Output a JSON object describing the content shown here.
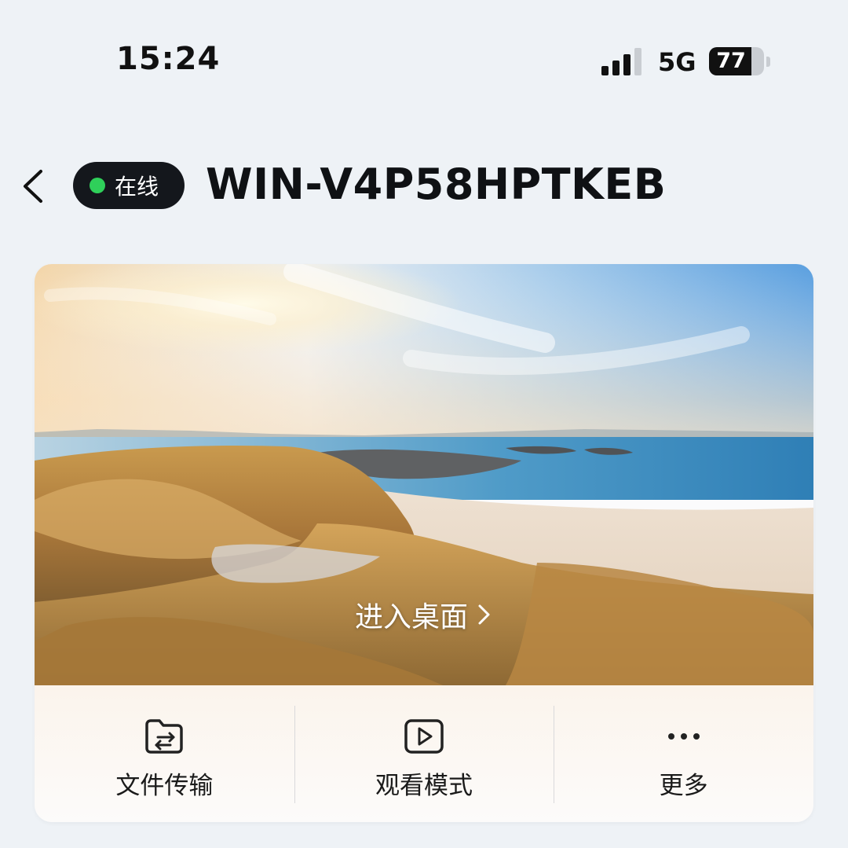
{
  "status_bar": {
    "time": "15:24",
    "network": "5G",
    "battery": "77",
    "battery_level": 0.77
  },
  "header": {
    "back_icon": "chevron-left-icon",
    "status": "在线",
    "status_color": "#2fd05a",
    "device_name": "WIN-V4P58HPTKEB"
  },
  "preview": {
    "enter_label": "进入桌面",
    "chevron_icon": "chevron-right-icon"
  },
  "actions": [
    {
      "label": "文件传输",
      "icon": "folder-transfer-icon"
    },
    {
      "label": "观看模式",
      "icon": "play-icon"
    },
    {
      "label": "更多",
      "icon": "more-dots-icon"
    }
  ]
}
